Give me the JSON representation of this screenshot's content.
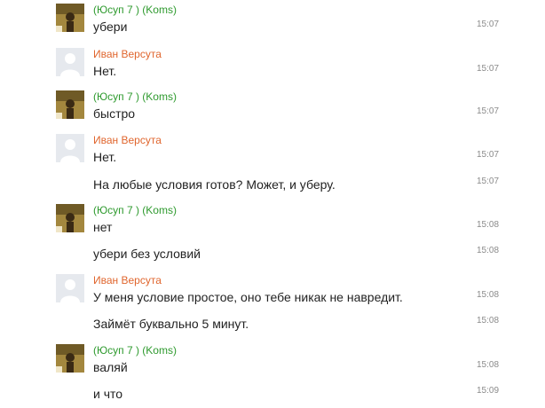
{
  "chat": {
    "users": {
      "yusup": {
        "name": "(Юсуп 7 ) (Koms)",
        "color": "#2e9a2e",
        "avatar_icon": "photo-avatar-icon"
      },
      "ivan": {
        "name": "Иван Версута",
        "color": "#e0662e",
        "avatar_icon": "default-avatar-icon"
      }
    },
    "messages": [
      {
        "author": "(Юсуп 7 ) (Koms)",
        "text": "убери",
        "time": "15:07"
      },
      {
        "author": "Иван Версута",
        "text": "Нет.",
        "time": "15:07"
      },
      {
        "author": "(Юсуп 7 ) (Koms)",
        "text": "быстро",
        "time": "15:07"
      },
      {
        "author": "Иван Версута",
        "text": "Нет.",
        "time": "15:07"
      },
      {
        "text": "На любые условия готов? Может, и уберу.",
        "time": "15:07"
      },
      {
        "author": "(Юсуп 7 ) (Koms)",
        "text": "нет",
        "time": "15:08"
      },
      {
        "text": "убери без условий",
        "time": "15:08"
      },
      {
        "author": "Иван Версута",
        "text": "У меня условие простое, оно тебе никак не навредит.",
        "time": "15:08"
      },
      {
        "text": "Займёт буквально 5 минут.",
        "time": "15:08"
      },
      {
        "author": "(Юсуп 7 ) (Koms)",
        "text": "валяй",
        "time": "15:08"
      },
      {
        "text": "и что",
        "time": "15:09"
      }
    ]
  }
}
